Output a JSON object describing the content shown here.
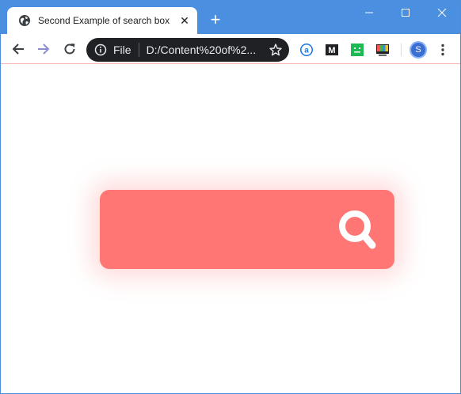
{
  "tab": {
    "title": "Second Example of search box",
    "close_glyph": "✕",
    "icon": "globe-icon"
  },
  "new_tab_glyph": "+",
  "address_bar": {
    "scheme": "File",
    "url": "D:/Content%20of%2...",
    "icons": [
      "info-icon",
      "star-icon"
    ]
  },
  "extensions": [
    "a-extension-icon",
    "m-extension-icon",
    "green-extension-icon",
    "tv-extension-icon"
  ],
  "profile": {
    "initial": "S"
  },
  "search": {
    "placeholder": "",
    "value": "",
    "icon": "search-icon"
  },
  "colors": {
    "tabstrip": "#4a8fe0",
    "omnibox": "#202124",
    "search_box": "#ff7675",
    "search_icon": "#ffffff"
  }
}
